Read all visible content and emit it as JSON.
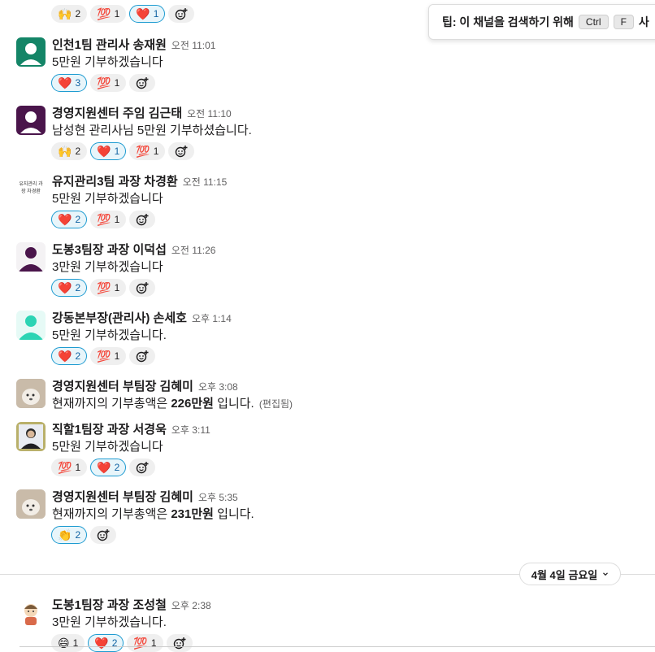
{
  "tip": {
    "text": "팁: 이 채널을 검색하기 위해",
    "key1": "Ctrl",
    "key2": "F",
    "trail": "사"
  },
  "top_reactions": [
    {
      "emoji": "🙌",
      "count": "2",
      "active": false
    },
    {
      "emoji": "💯",
      "count": "1",
      "active": false
    },
    {
      "emoji": "❤️",
      "count": "1",
      "active": true
    }
  ],
  "messages": [
    {
      "name": "인천1팀 관리사 송재원",
      "time": "오전 11:01",
      "text": "5만원 기부하겠습니다",
      "reactions": [
        {
          "emoji": "❤️",
          "count": "3",
          "active": true
        },
        {
          "emoji": "💯",
          "count": "1",
          "active": false
        }
      ]
    },
    {
      "name": "경영지원센터 주임 김근태",
      "time": "오전 11:10",
      "text": "남성현 관리사님 5만원 기부하셨습니다.",
      "reactions": [
        {
          "emoji": "🙌",
          "count": "2",
          "active": false
        },
        {
          "emoji": "❤️",
          "count": "1",
          "active": true
        },
        {
          "emoji": "💯",
          "count": "1",
          "active": false
        }
      ]
    },
    {
      "name": "유지관리3팀 과장 차경환",
      "time": "오전 11:15",
      "text": "5만원 기부하겠습니다",
      "avatar_text": "유지관리 과장 차경환",
      "reactions": [
        {
          "emoji": "❤️",
          "count": "2",
          "active": true
        },
        {
          "emoji": "💯",
          "count": "1",
          "active": false
        }
      ]
    },
    {
      "name": "도봉3팀장 과장 이덕섭",
      "time": "오전 11:26",
      "text": "3만원 기부하겠습니다",
      "reactions": [
        {
          "emoji": "❤️",
          "count": "2",
          "active": true
        },
        {
          "emoji": "💯",
          "count": "1",
          "active": false
        }
      ]
    },
    {
      "name": "강동본부장(관리사) 손세호",
      "time": "오후 1:14",
      "text": "5만원 기부하겠습니다.",
      "reactions": [
        {
          "emoji": "❤️",
          "count": "2",
          "active": true
        },
        {
          "emoji": "💯",
          "count": "1",
          "active": false
        }
      ]
    },
    {
      "name": "경영지원센터 부팀장 김혜미",
      "time": "오후 3:08",
      "text_pre": "현재까지의 기부총액은 ",
      "text_bold": "226만원",
      "text_post": " 입니다.",
      "edited": "(편집됨)"
    },
    {
      "name": "직할1팀장 과장 서경욱",
      "time": "오후 3:11",
      "text": "5만원 기부하겠습니다",
      "reactions": [
        {
          "emoji": "💯",
          "count": "1",
          "active": false
        },
        {
          "emoji": "❤️",
          "count": "2",
          "active": true
        }
      ]
    },
    {
      "name": "경영지원센터 부팀장 김혜미",
      "time": "오후 5:35",
      "text_pre": "현재까지의 기부총액은 ",
      "text_bold": "231만원",
      "text_post": " 입니다.",
      "reactions": [
        {
          "emoji": "👏",
          "count": "2",
          "active": true
        }
      ]
    },
    {
      "name": "도봉1팀장 과장 조성철",
      "time": "오후 2:38",
      "text": "3만원 기부하겠습니다.",
      "reactions": [
        {
          "emoji": "😄",
          "count": "1",
          "active": false
        },
        {
          "emoji": "❤️",
          "count": "2",
          "active": true
        },
        {
          "emoji": "💯",
          "count": "1",
          "active": false
        }
      ]
    }
  ],
  "date_divider": {
    "label": "4월 4일 금요일"
  },
  "colors": {
    "accent": "#1d9bd1",
    "active_bg": "#e8f5fa",
    "reaction_bg": "#efefef",
    "name": "#1d1c1d",
    "time": "#616061"
  }
}
